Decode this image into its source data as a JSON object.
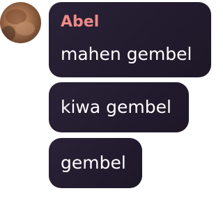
{
  "chat": {
    "sender_name": "Abel",
    "colors": {
      "sender_name": "#ee8a86",
      "bubble_background": "#241d30",
      "message_text": "#ffffff"
    },
    "messages": [
      {
        "text": "mahen gembel"
      },
      {
        "text": "kiwa gembel"
      },
      {
        "text": "gembel"
      }
    ]
  }
}
